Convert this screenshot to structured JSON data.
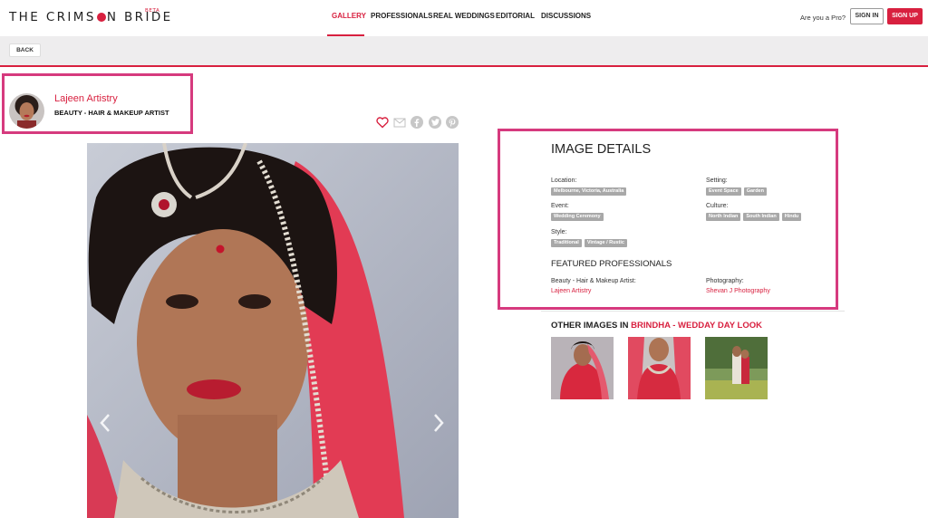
{
  "header": {
    "logo": {
      "part1": "THE CRIMS",
      "part2": "N BRIDE",
      "badge": "BETA"
    },
    "nav": [
      "GALLERY",
      "PROFESSIONALS",
      "REAL WEDDINGS",
      "EDITORIAL",
      "DISCUSSIONS"
    ],
    "active_nav": "GALLERY",
    "pro_prompt": "Are you a Pro?",
    "sign_in": "SIGN IN",
    "sign_up": "SIGN UP"
  },
  "back_label": "BACK",
  "professional": {
    "name": "Lajeen Artistry",
    "role": "BEAUTY - HAIR & MAKEUP ARTIST"
  },
  "share_icons": [
    "heart-icon",
    "email-icon",
    "facebook-icon",
    "twitter-icon",
    "pinterest-icon"
  ],
  "image_details": {
    "title": "IMAGE DETAILS",
    "location": {
      "label": "Location:",
      "tags": [
        "Melbourne, Victoria, Australia"
      ]
    },
    "setting": {
      "label": "Setting:",
      "tags": [
        "Event Space",
        "Garden"
      ]
    },
    "event": {
      "label": "Event:",
      "tags": [
        "Wedding Ceremony"
      ]
    },
    "culture": {
      "label": "Culture:",
      "tags": [
        "North Indian",
        "South Indian",
        "Hindu"
      ]
    },
    "style": {
      "label": "Style:",
      "tags": [
        "Traditional",
        "Vintage / Rustic"
      ]
    }
  },
  "featured": {
    "title": "FEATURED PROFESSIONALS",
    "items": [
      {
        "category": "Beauty - Hair & Makeup Artist:",
        "name": "Lajeen Artistry"
      },
      {
        "category": "Photography:",
        "name": "Shevan J Photography"
      }
    ]
  },
  "other_images": {
    "prefix": "OTHER IMAGES IN",
    "album": "BRINDHA - WEDDAY DAY LOOK"
  },
  "colors": {
    "accent": "#d8203f",
    "highlight": "#d63a7e"
  }
}
